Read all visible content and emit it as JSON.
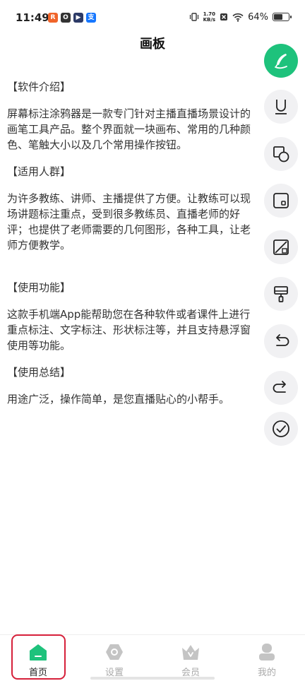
{
  "status": {
    "time": "11:49",
    "apps": [
      {
        "icon": "app-badge-orange",
        "char": "R",
        "color": "#f0642a"
      },
      {
        "icon": "app-badge-dark",
        "char": "O",
        "color": "#333333"
      },
      {
        "icon": "app-badge-play",
        "char": "▶",
        "color": "#2c3a66"
      },
      {
        "icon": "app-badge-blue",
        "char": "支",
        "color": "#1677ff"
      }
    ],
    "net_speed_value": "1.70",
    "net_speed_unit": "KB/s",
    "battery": "64%",
    "battery_level": 0.64
  },
  "header": {
    "title": "画板"
  },
  "content": {
    "sections": [
      {
        "heading": "【软件介绍】",
        "text": "屏幕标注涂鸦器是一款专门针对主播直播场景设计的画笔工具产品。整个界面就一块画布、常用的几种颜色、笔触大小以及几个常用操作按钮。"
      },
      {
        "heading": "【适用人群】",
        "text": "为许多教练、讲师、主播提供了方便。让教练可以现场讲题标注重点，受到很多教练员、直播老师的好评；也提供了老师需要的几何图形，各种工具，让老师方便教学。"
      },
      {
        "heading": "【使用功能】",
        "text": "这款手机端App能帮助您在各种软件或者课件上进行重点标注、文字标注、形状标注等，并且支持悬浮窗使用等功能。"
      },
      {
        "heading": "【使用总结】",
        "text": "用途广泛，操作简单，是您直播贴心的小帮手。"
      }
    ]
  },
  "tools": [
    {
      "icon": "pen-icon",
      "active": true
    },
    {
      "icon": "underline-icon",
      "active": false
    },
    {
      "icon": "shapes-icon",
      "active": false
    },
    {
      "icon": "rectangle-dot-icon",
      "active": false
    },
    {
      "icon": "eraser-box-icon",
      "active": false
    },
    {
      "icon": "paint-roller-icon",
      "active": false
    },
    {
      "icon": "undo-icon",
      "active": false
    },
    {
      "icon": "redo-icon",
      "active": false
    },
    {
      "icon": "check-circle-icon",
      "active": false
    }
  ],
  "tabbar": {
    "tabs": [
      {
        "label": "首页",
        "icon": "home-icon",
        "active": true
      },
      {
        "label": "设置",
        "icon": "settings-icon",
        "active": false
      },
      {
        "label": "会员",
        "icon": "crown-icon",
        "active": false
      },
      {
        "label": "我的",
        "icon": "profile-icon",
        "active": false
      }
    ]
  },
  "colors": {
    "accent": "#1ec27c",
    "highlight": "#d6203a"
  }
}
